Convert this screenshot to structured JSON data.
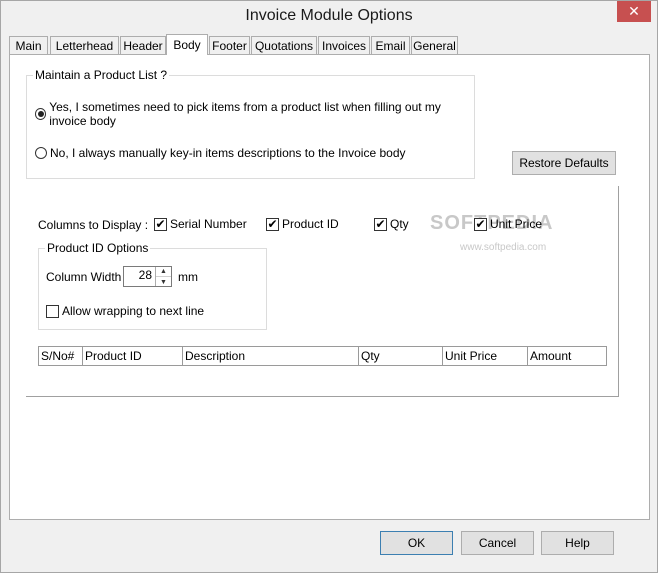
{
  "window": {
    "title": "Invoice Module Options",
    "close_glyph": "✕"
  },
  "tabs": [
    {
      "label": "Main"
    },
    {
      "label": "Letterhead"
    },
    {
      "label": "Header"
    },
    {
      "label": "Body"
    },
    {
      "label": "Footer"
    },
    {
      "label": "Quotations"
    },
    {
      "label": "Invoices"
    },
    {
      "label": "Email"
    },
    {
      "label": "General"
    }
  ],
  "active_tab": "Body",
  "product_list": {
    "title": "Maintain a Product List ?",
    "option_yes": "Yes, I sometimes need to pick items from a product list when filling out my invoice body",
    "option_no": "No, I always manually key-in items descriptions to the Invoice body",
    "selected": "yes"
  },
  "restore_defaults_label": "Restore Defaults",
  "columns_to_display": {
    "label": "Columns to Display :",
    "items": [
      {
        "label": "Serial Number",
        "checked": true,
        "mark": "✔"
      },
      {
        "label": "Product ID",
        "checked": true,
        "mark": "✔"
      },
      {
        "label": "Qty",
        "checked": true,
        "mark": "✔"
      },
      {
        "label": "Unit Price",
        "checked": true,
        "mark": "✔"
      }
    ]
  },
  "product_id_options": {
    "title": "Product ID Options",
    "column_width_label": "Column Width",
    "column_width_value": "28",
    "unit": "mm",
    "wrap_label": "Allow wrapping to next line",
    "wrap_checked": false
  },
  "grid_columns": [
    "S/No#",
    "Product ID",
    "Description",
    "Qty",
    "Unit Price",
    "Amount"
  ],
  "watermark": {
    "text": "SOFTPEDIA",
    "sub": "www.softpedia.com"
  },
  "buttons": {
    "ok": "OK",
    "cancel": "Cancel",
    "help": "Help"
  },
  "colors": {
    "close_button": "#c75050",
    "default_button_border": "#3c7fb1"
  },
  "icons": {
    "close": "close-icon",
    "spin_up": "chevron-up-icon",
    "spin_down": "chevron-down-icon",
    "check": "check-icon"
  }
}
